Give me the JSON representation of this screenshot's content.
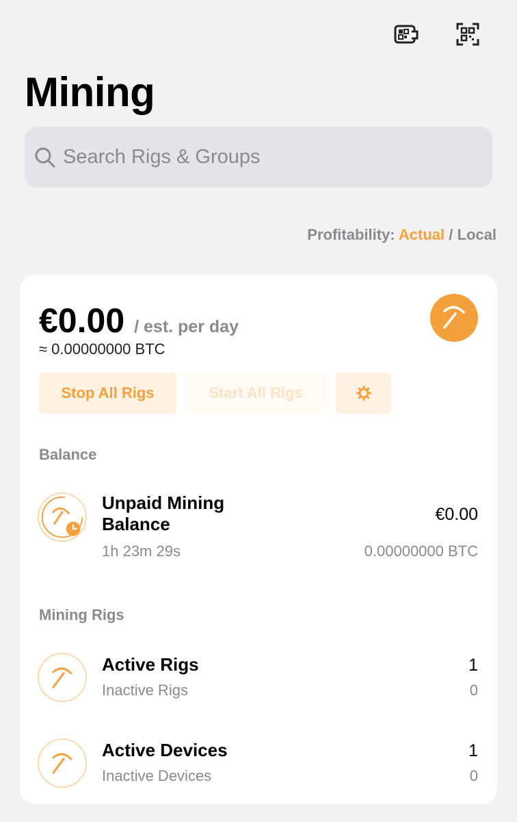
{
  "header": {
    "title": "Mining",
    "icons": [
      "wallet-qr-icon",
      "qr-scan-icon"
    ]
  },
  "search": {
    "placeholder": "Search Rigs & Groups",
    "value": ""
  },
  "profitability": {
    "label": "Profitability:",
    "actual": "Actual",
    "separator": "/",
    "local": "Local"
  },
  "summary": {
    "amount": "€0.00",
    "suffix": "/ est. per day",
    "btc": "≈ 0.00000000 BTC",
    "stop_label": "Stop All Rigs",
    "start_label": "Start All Rigs"
  },
  "balance": {
    "section_label": "Balance",
    "title": "Unpaid Mining Balance",
    "timer": "1h 23m 29s",
    "value": "€0.00",
    "btc": "0.00000000 BTC"
  },
  "rigs": {
    "section_label": "Mining Rigs",
    "items": [
      {
        "title": "Active Rigs",
        "subtitle": "Inactive Rigs",
        "value": "1",
        "subvalue": "0"
      },
      {
        "title": "Active Devices",
        "subtitle": "Inactive Devices",
        "value": "1",
        "subvalue": "0"
      }
    ]
  },
  "colors": {
    "accent": "#f5a03c",
    "background": "#f2f2f4",
    "muted": "#8a8a8e"
  }
}
